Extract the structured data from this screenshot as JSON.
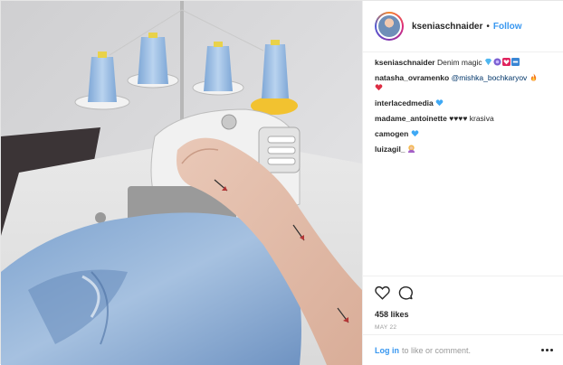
{
  "post": {
    "username": "kseniaschnaider",
    "separator": "•",
    "follow_label": "Follow",
    "photo_icon": "post-photo-image"
  },
  "comments": [
    {
      "user": "kseniaschnaider",
      "text": " Denim magic ",
      "emoji": [
        "gem-emoji",
        "blue-sparkle-emoji",
        "red-heart-box-emoji",
        "blue-square-emoji"
      ]
    },
    {
      "user": "natasha_ovramenko",
      "mention": " @mishka_bochkaryov ",
      "emoji": [
        "fire-emoji",
        "red-heart-emoji"
      ]
    },
    {
      "user": "interlacedmedia",
      "text": " ",
      "emoji": [
        "blue-heart-emoji"
      ]
    },
    {
      "user": "madame_antoinette",
      "text": " ♥♥♥♥ krasiva",
      "emoji": []
    },
    {
      "user": "camogen",
      "text": " ",
      "emoji": [
        "blue-heart-emoji"
      ]
    },
    {
      "user": "luizagil_",
      "text": " ",
      "emoji": [
        "woman-emoji"
      ]
    }
  ],
  "actions": {
    "like_icon": "heart-outline-icon",
    "comment_icon": "comment-bubble-icon",
    "likes": "458 likes",
    "date": "MAY 22"
  },
  "footer": {
    "login_label": "Log in",
    "text": "to like or comment.",
    "more_icon": "more-options-icon"
  },
  "colors": {
    "link_blue": "#3897f0",
    "border": "#efefef",
    "muted": "#999999"
  }
}
